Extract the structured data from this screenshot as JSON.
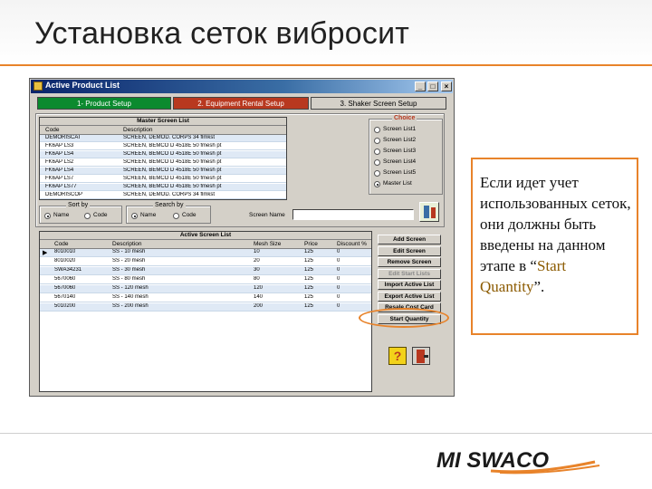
{
  "slide": {
    "title": "Установка сеток вибросит",
    "callout_before": "Если идет учет использованных сеток, они должны быть введены на данном этапе в “",
    "callout_accent": "Start Quantity",
    "callout_after": "”."
  },
  "window": {
    "title": "Active Product List",
    "controls": {
      "minimize": "_",
      "maximize": "□",
      "close": "×"
    },
    "tabs": [
      {
        "label": "1- Product Setup",
        "color": "#0b8a2e"
      },
      {
        "label": "2. Equipment Rental Setup",
        "color": "#b8381f"
      },
      {
        "label": "3. Shaker Screen Setup",
        "color": "#d4d0c8"
      }
    ]
  },
  "master": {
    "title": "Master Screen List",
    "columns": [
      "Code",
      "Description"
    ],
    "rows": [
      [
        "DEMORISCAT",
        "SCREEN, DEMOD. CORPS 34 flmkst"
      ],
      [
        "FK6AP LS3",
        "SCREEN, BEMCO D 4518E 50 fmesh pt"
      ],
      [
        "FK6AP LS4",
        "SCREEN, BEMCO D 4518E 50 fmesh pt"
      ],
      [
        "FK6AP LS2",
        "SCREEN, BEMCO D 4518E 50 fmesh pt"
      ],
      [
        "FK6AP LS4",
        "SCREEN, BEMCO D 4518E 50 fmesh pt"
      ],
      [
        "FK6AP LS7",
        "SCREEN, BEMCO D 4518E 50 fmesh pt"
      ],
      [
        "FK6AP LS77",
        "SCREEN, BEMCO D 4518E 50 fmesh pt"
      ],
      [
        "DEMORISCOP",
        "SCREEN, DEMOD. CORPS 34 flmkst"
      ]
    ],
    "sort_by": {
      "title": "Sort by",
      "options": [
        "Name",
        "Code"
      ],
      "selected": 0
    },
    "search_by": {
      "title": "Search by",
      "options": [
        "Name",
        "Code"
      ],
      "selected": 0
    },
    "screen_name_label": "Screen Name",
    "screen_name_value": ""
  },
  "choice": {
    "title": "Choice",
    "options": [
      "Screen List1",
      "Screen List2",
      "Screen List3",
      "Screen List4",
      "Screen List5",
      "Master List"
    ],
    "selected": 5
  },
  "active": {
    "title": "Active Screen List",
    "columns": [
      "Code",
      "Description",
      "Mesh Size",
      "Price",
      "Discount %"
    ],
    "rows": [
      [
        "8010010",
        "SS - 10 mesh",
        "10",
        "125",
        "0"
      ],
      [
        "8010020",
        "SS - 20 mesh",
        "20",
        "125",
        "0"
      ],
      [
        "SWA34231",
        "SS - 30 mesh",
        "30",
        "125",
        "0"
      ],
      [
        "5670060",
        "SS - 80 mesh",
        "80",
        "125",
        "0"
      ],
      [
        "5670060",
        "SS - 120 mesh",
        "120",
        "125",
        "0"
      ],
      [
        "5670140",
        "SS - 140 mesh",
        "140",
        "125",
        "0"
      ],
      [
        "5010200",
        "SS - 200 mesh",
        "200",
        "125",
        "0"
      ]
    ]
  },
  "buttons": [
    {
      "label": "Add Screen",
      "disabled": false
    },
    {
      "label": "Edit Screen",
      "disabled": false
    },
    {
      "label": "Remove Screen",
      "disabled": false
    },
    {
      "label": "Edit Start Lists",
      "disabled": true
    },
    {
      "label": "Import Active List",
      "disabled": false
    },
    {
      "label": "Export Active List",
      "disabled": false
    },
    {
      "label": "Resale Cost Card",
      "disabled": false
    },
    {
      "label": "Start Quantity",
      "disabled": false
    }
  ],
  "logo": {
    "text": "MI SWACO",
    "color": "#1a1a1a",
    "accent": "#e8832a"
  }
}
